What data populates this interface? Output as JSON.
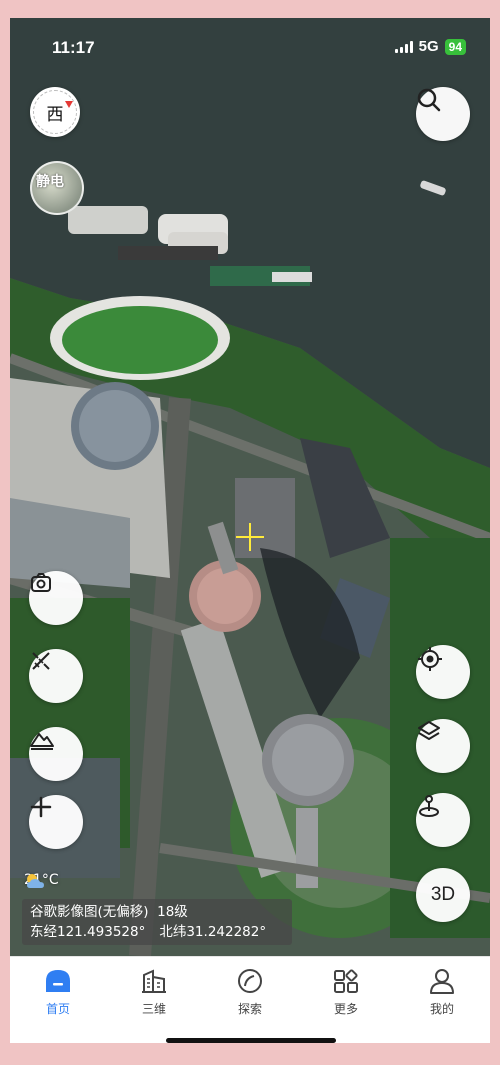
{
  "status_bar": {
    "time": "11:17",
    "network": "5G",
    "battery": "94"
  },
  "map": {
    "compass_label": "西",
    "layer_thumb_label": "静电",
    "weather": "21°C",
    "source_line": "谷歌影像图(无偏移)  18级",
    "longitude": "东经121.493528°",
    "latitude": "北纬31.242282°"
  },
  "controls": {
    "search_icon": "search-icon",
    "camera_icon": "camera-icon",
    "measure_icon": "ruler-pencil-icon",
    "terrain_icon": "mountain-icon",
    "add_icon": "plus-icon",
    "locate_icon": "locate-icon",
    "layers_icon": "layers-icon",
    "place_icon": "person-pin-icon",
    "three_d_label": "3D"
  },
  "tabbar": {
    "items": [
      {
        "label": "首页",
        "icon": "home-icon",
        "active": true
      },
      {
        "label": "三维",
        "icon": "buildings-icon",
        "active": false
      },
      {
        "label": "探索",
        "icon": "compass-icon",
        "active": false
      },
      {
        "label": "更多",
        "icon": "grid-icon",
        "active": false
      },
      {
        "label": "我的",
        "icon": "user-icon",
        "active": false
      }
    ]
  },
  "colors": {
    "accent": "#2f7ef2",
    "battery": "#38c03b",
    "crosshair": "#ffeb3b"
  }
}
